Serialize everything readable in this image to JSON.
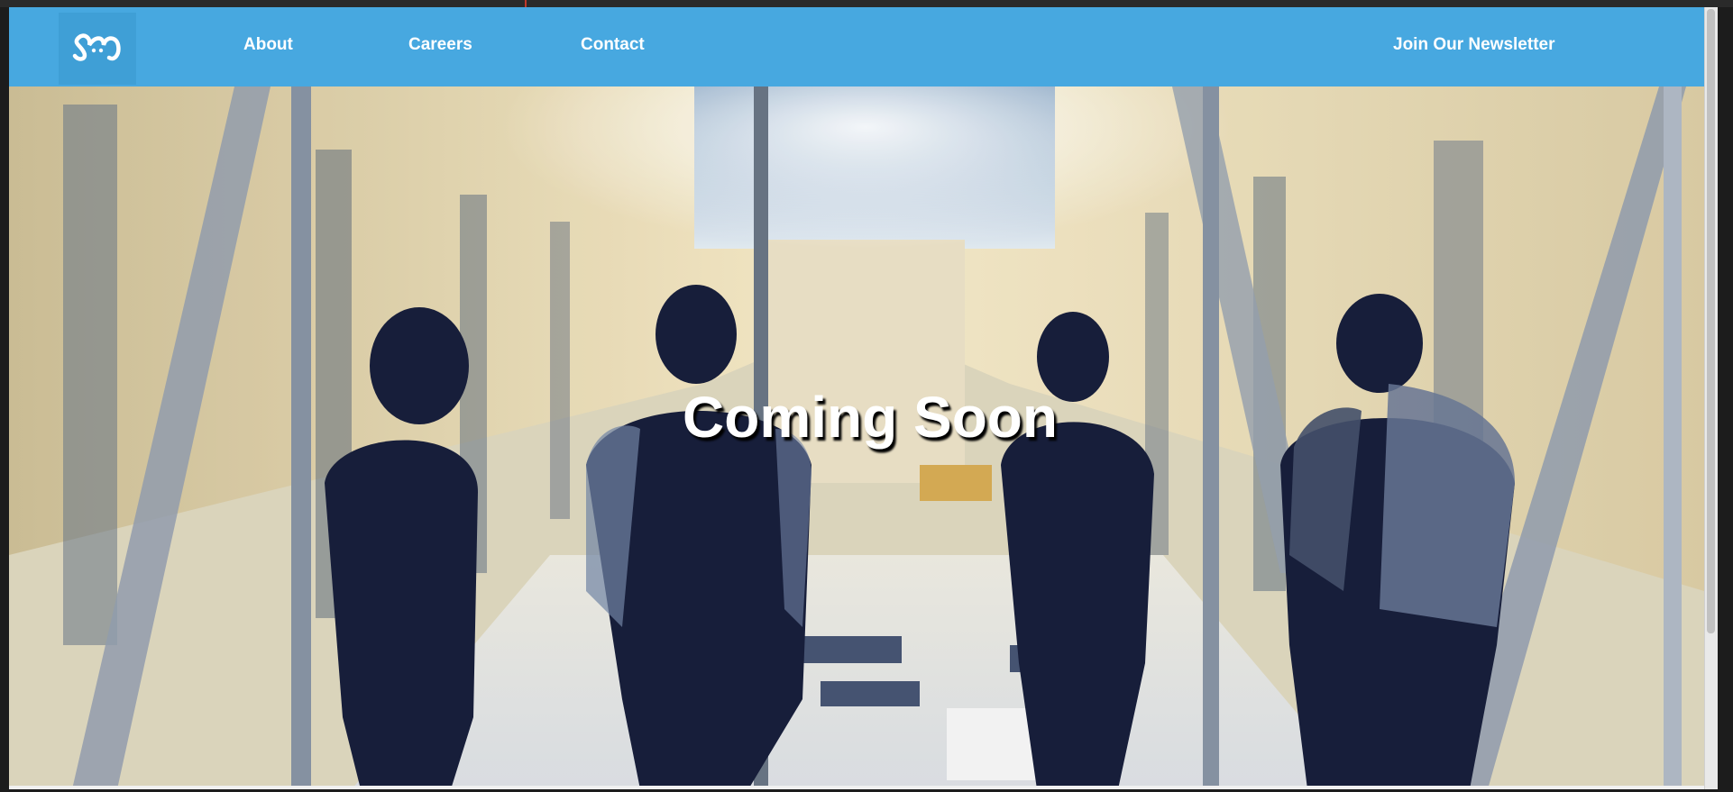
{
  "nav": {
    "logo_alt": "company-logo",
    "links": [
      {
        "label": "About"
      },
      {
        "label": "Careers"
      },
      {
        "label": "Contact"
      }
    ],
    "newsletter_label": "Join Our Newsletter"
  },
  "hero": {
    "title": "Coming Soon",
    "image_semantic": "people-silhouettes-overlooking-warehouse-workspace"
  },
  "colors": {
    "nav_bg": "#47a8e0",
    "hero_text": "#ffffff"
  }
}
